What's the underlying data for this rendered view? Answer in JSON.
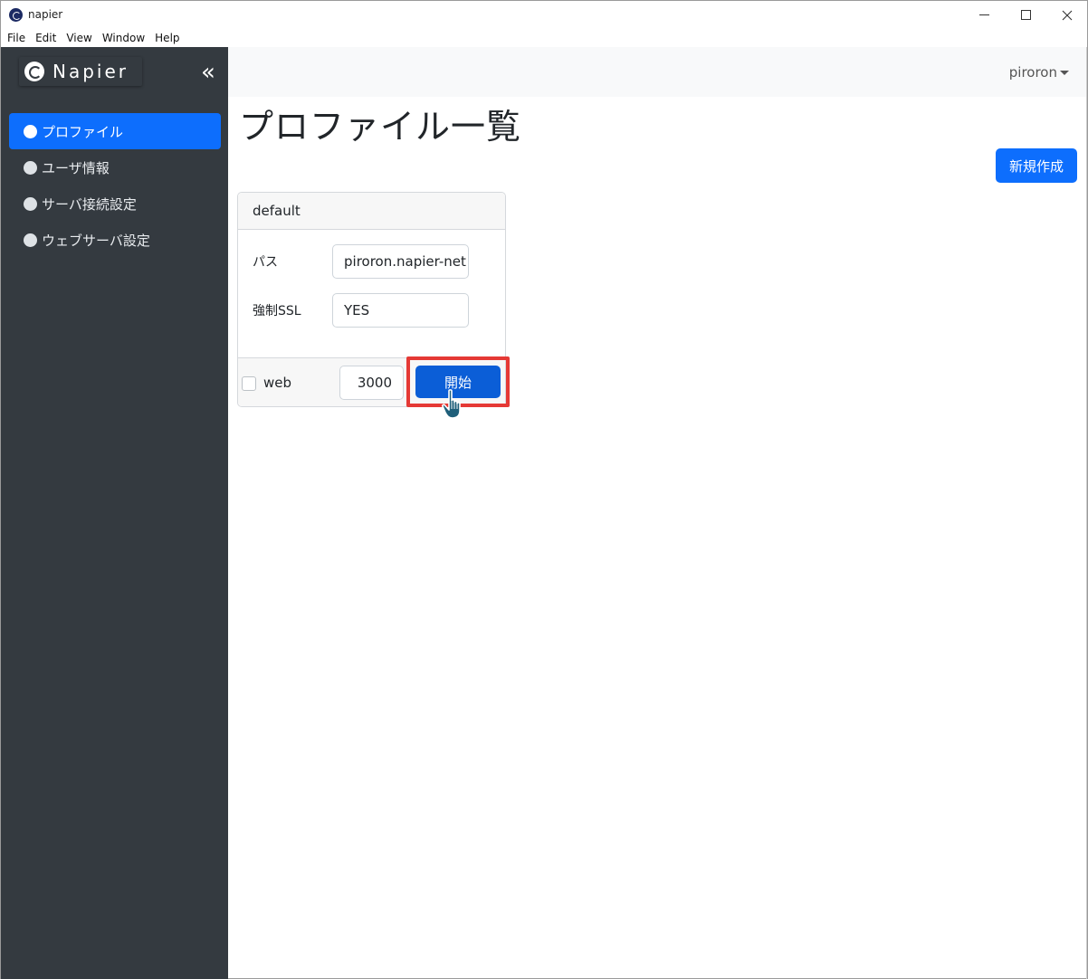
{
  "window": {
    "title": "napier",
    "menu": [
      "File",
      "Edit",
      "View",
      "Window",
      "Help"
    ]
  },
  "sidebar": {
    "brand": "Napier",
    "collapse_icon": "«",
    "items": [
      {
        "label": "プロファイル",
        "active": true
      },
      {
        "label": "ユーザ情報",
        "active": false
      },
      {
        "label": "サーバ接続設定",
        "active": false
      },
      {
        "label": "ウェブサーバ設定",
        "active": false
      }
    ]
  },
  "header": {
    "user": "piroron"
  },
  "main": {
    "title": "プロファイル一覧",
    "new_button": "新規作成",
    "profile": {
      "name": "default",
      "fields": [
        {
          "label": "パス",
          "value": "piroron.napier-net"
        },
        {
          "label": "強制SSL",
          "value": "YES"
        }
      ],
      "web_label": "web",
      "web_checked": false,
      "port": "3000",
      "start_button": "開始"
    }
  },
  "colors": {
    "sidebar_bg": "#343a40",
    "accent": "#0d6efd",
    "highlight": "#e53935"
  }
}
